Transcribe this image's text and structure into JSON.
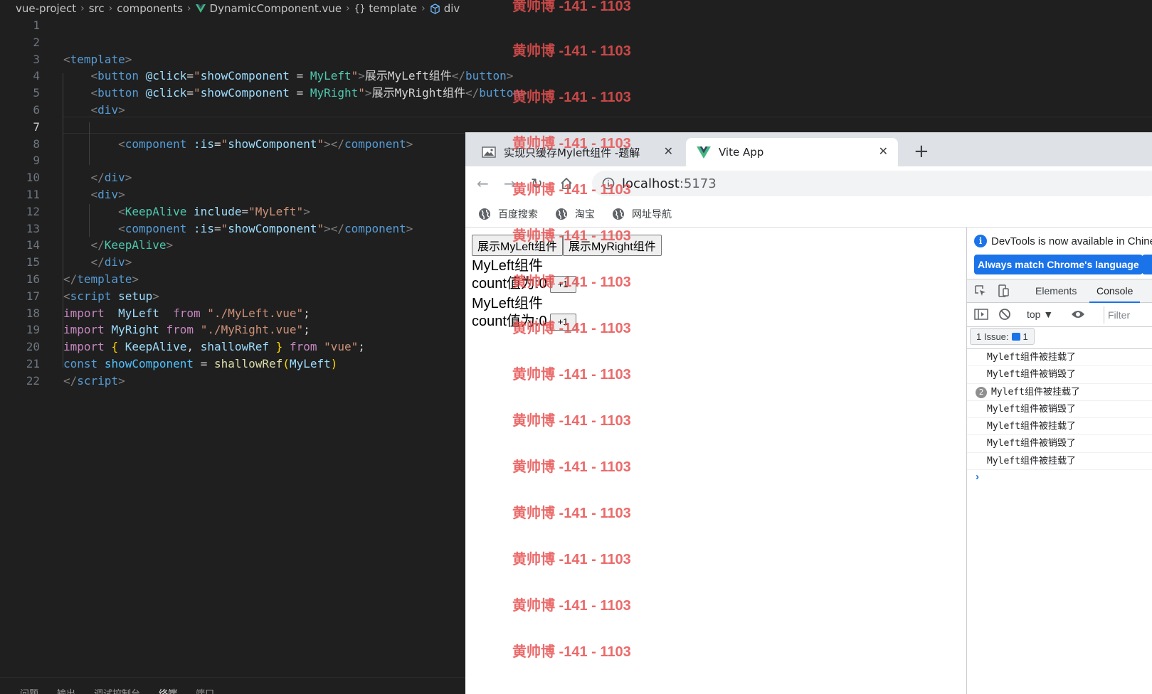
{
  "breadcrumb": [
    "vue-project",
    "src",
    "components",
    "DynamicComponent.vue",
    "template",
    "div"
  ],
  "editor": {
    "line_numbers": [
      "1",
      "2",
      "3",
      "4",
      "5",
      "6",
      "7",
      "8",
      "9",
      "10",
      "11",
      "12",
      "13",
      "14",
      "15",
      "16",
      "17",
      "18",
      "19",
      "20",
      "21",
      "22"
    ],
    "active_line": "7"
  },
  "panel_tabs": [
    "问题",
    "输出",
    "调试控制台",
    "终端",
    "端口"
  ],
  "browser": {
    "tabs": [
      {
        "title": "实现只缓存Myleft组件 -题解",
        "close": "✕"
      },
      {
        "title": "Vite App",
        "close": "✕"
      }
    ],
    "new_tab": "+",
    "url_host": "localhost",
    "url_port": ":5173",
    "bookmarks": [
      "百度搜索",
      "淘宝",
      "网址导航"
    ]
  },
  "page": {
    "buttons": [
      "展示MyLeft组件",
      "展示MyRight组件"
    ],
    "components": [
      {
        "name": "MyLeft组件",
        "count_label": "count值为:0",
        "button": "+1"
      },
      {
        "name": "MyLeft组件",
        "count_label": "count值为:0",
        "button": "+1"
      }
    ]
  },
  "devtools": {
    "notice": "DevTools is now available in Chinese",
    "match_button": "Always match Chrome's language",
    "tabs": [
      "Elements",
      "Console"
    ],
    "active_tab": "Console",
    "context": "top ▼",
    "filter_placeholder": "Filter",
    "issues": "1 Issue:",
    "issues_count": "1",
    "logs": [
      {
        "text": "Myleft组件被挂载了",
        "count": ""
      },
      {
        "text": "Myleft组件被销毁了",
        "count": ""
      },
      {
        "text": "Myleft组件被挂载了",
        "count": "2"
      },
      {
        "text": "Myleft组件被销毁了",
        "count": ""
      },
      {
        "text": "Myleft组件被挂载了",
        "count": ""
      },
      {
        "text": "Myleft组件被销毁了",
        "count": ""
      },
      {
        "text": "Myleft组件被挂载了",
        "count": ""
      }
    ],
    "prompt": "›"
  },
  "watermark": "黄帅博 -141 - 1103",
  "colors": {
    "accent": "#1a73e8",
    "watermark": "#e85050",
    "editor_bg": "#1f1f1f"
  }
}
